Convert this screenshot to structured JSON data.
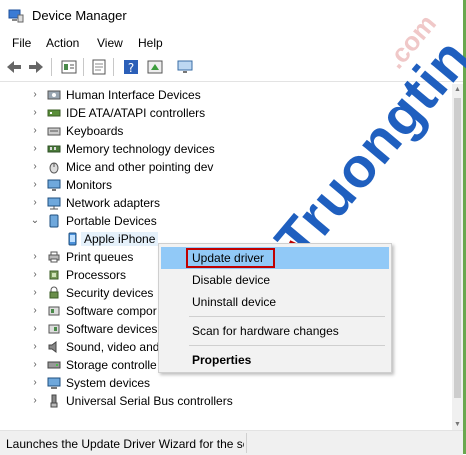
{
  "window": {
    "title": "Device Manager",
    "title_icon": "device-manager-icon"
  },
  "menu": [
    "File",
    "Action",
    "View",
    "Help"
  ],
  "toolbar": {
    "icons": [
      "back-arrow-icon",
      "forward-arrow-icon",
      "properties-icon",
      "scan-icon",
      "help-icon",
      "update-driver-icon",
      "monitor-icon"
    ]
  },
  "tree": {
    "items": [
      {
        "label": "Human Interface Devices",
        "icon": "hid-icon",
        "expanded": false
      },
      {
        "label": "IDE ATA/ATAPI controllers",
        "icon": "ide-icon",
        "expanded": false
      },
      {
        "label": "Keyboards",
        "icon": "keyboard-icon",
        "expanded": false
      },
      {
        "label": "Memory technology devices",
        "icon": "memory-icon",
        "expanded": false
      },
      {
        "label": "Mice and other pointing dev",
        "icon": "mouse-icon",
        "expanded": false
      },
      {
        "label": "Monitors",
        "icon": "monitor-icon",
        "expanded": false
      },
      {
        "label": "Network adapters",
        "icon": "network-icon",
        "expanded": false
      },
      {
        "label": "Portable Devices",
        "icon": "portable-device-icon",
        "expanded": true
      },
      {
        "label": "Apple iPhone",
        "icon": "phone-icon",
        "child": true,
        "selected": true
      },
      {
        "label": "Print queues",
        "icon": "printer-icon",
        "expanded": false
      },
      {
        "label": "Processors",
        "icon": "processor-icon",
        "expanded": false
      },
      {
        "label": "Security devices",
        "icon": "security-icon",
        "expanded": false
      },
      {
        "label": "Software compor",
        "icon": "software-component-icon",
        "expanded": false
      },
      {
        "label": "Software devices",
        "icon": "software-device-icon",
        "expanded": false
      },
      {
        "label": "Sound, video and",
        "icon": "sound-icon",
        "expanded": false
      },
      {
        "label": "Storage controlle",
        "icon": "storage-icon",
        "expanded": false
      },
      {
        "label": "System devices",
        "icon": "system-icon",
        "expanded": false
      },
      {
        "label": "Universal Serial Bus controllers",
        "icon": "usb-icon",
        "expanded": false
      }
    ]
  },
  "context_menu": {
    "update_driver": "Update driver",
    "disable_device": "Disable device",
    "uninstall_device": "Uninstall device",
    "scan": "Scan for hardware changes",
    "properties": "Properties"
  },
  "status": {
    "text": "Launches the Update Driver Wizard for the sel"
  },
  "watermark": {
    "main": "Truongtin",
    "secondary": ".com"
  },
  "colors": {
    "highlight": "#91c9f7",
    "selection": "#e5f1fb",
    "watermark": "#1f5fbf",
    "red_box": "#c00000"
  }
}
